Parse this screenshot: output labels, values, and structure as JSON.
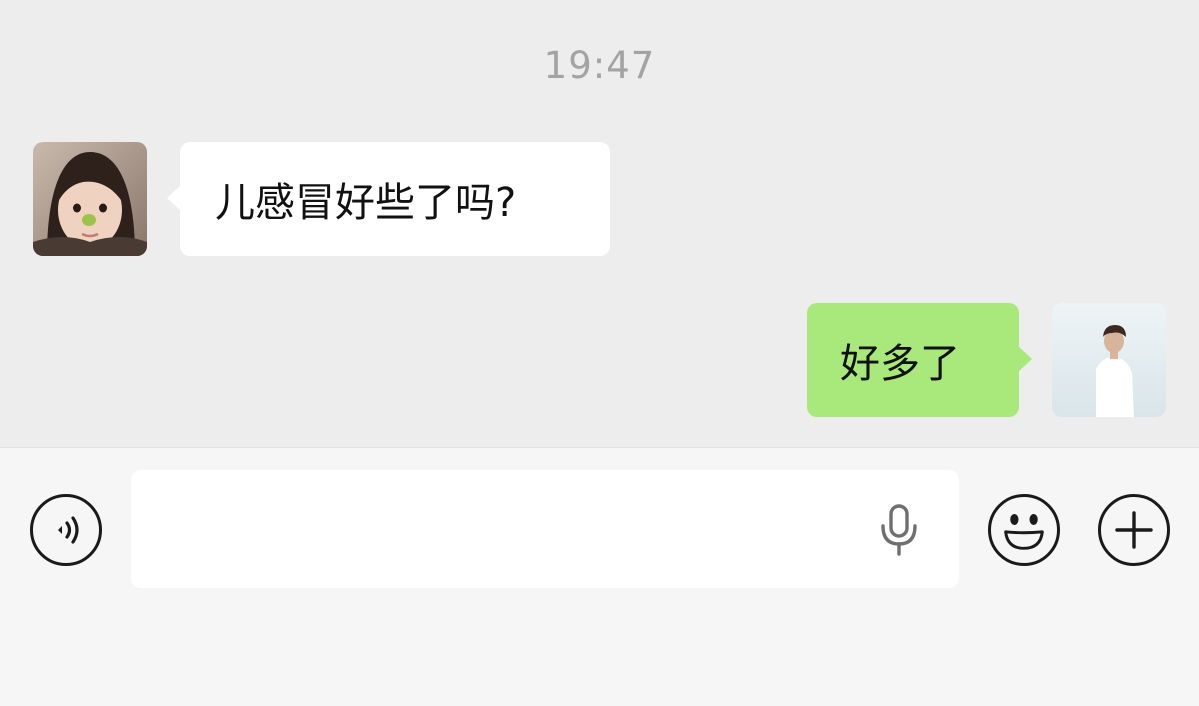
{
  "chat": {
    "timestamp": "19:47",
    "messages": [
      {
        "direction": "incoming",
        "text": "儿感冒好些了吗?"
      },
      {
        "direction": "outgoing",
        "text": "好多了"
      }
    ]
  },
  "input_bar": {
    "text_value": "",
    "placeholder": "",
    "icons": [
      "voice-icon",
      "microphone-icon",
      "emoji-icon",
      "plus-icon"
    ]
  },
  "colors": {
    "chat_background": "#ededed",
    "incoming_bubble": "#ffffff",
    "outgoing_bubble": "#a9e87a",
    "timestamp_text": "#a3a3a3",
    "input_bar_background": "#f6f6f6"
  }
}
